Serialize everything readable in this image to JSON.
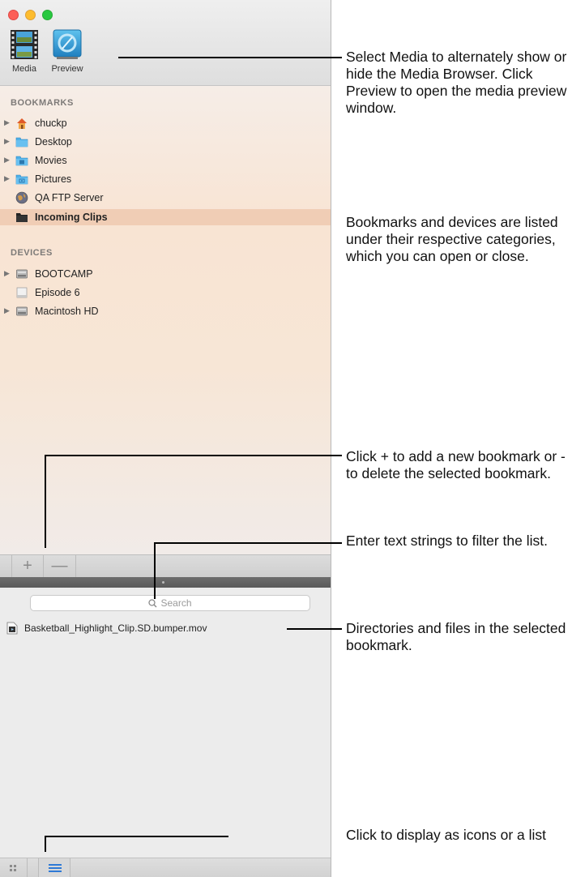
{
  "toolbar": {
    "media_label": "Media",
    "preview_label": "Preview"
  },
  "sidebar": {
    "bookmarks_header": "BOOKMARKS",
    "bookmarks": [
      {
        "label": "chuckp",
        "icon": "home-folder-icon",
        "expandable": true
      },
      {
        "label": "Desktop",
        "icon": "folder-icon",
        "expandable": true
      },
      {
        "label": "Movies",
        "icon": "movies-folder-icon",
        "expandable": true
      },
      {
        "label": "Pictures",
        "icon": "pictures-folder-icon",
        "expandable": true
      },
      {
        "label": "QA FTP Server",
        "icon": "globe-icon",
        "expandable": false
      },
      {
        "label": "Incoming Clips",
        "icon": "black-folder-icon",
        "expandable": false,
        "selected": true
      }
    ],
    "devices_header": "DEVICES",
    "devices": [
      {
        "label": "BOOTCAMP",
        "icon": "drive-icon",
        "expandable": true
      },
      {
        "label": "Episode 6",
        "icon": "disk-image-icon",
        "expandable": false
      },
      {
        "label": "Macintosh HD",
        "icon": "drive-icon",
        "expandable": true
      }
    ]
  },
  "bottom_bar": {
    "add_label": "+",
    "remove_label": "—"
  },
  "browser": {
    "search_placeholder": "Search",
    "files": [
      {
        "name": "Basketball_Highlight_Clip.SD.bumper.mov",
        "icon": "movie-file-icon"
      }
    ]
  },
  "annotations": {
    "toolbar": "Select Media to alternately show or hide the Media Browser. Click Preview to open the media preview window.",
    "bookmarks": "Bookmarks and devices are listed under their respective categories, which you can open or close.",
    "add_remove": "Click + to add a new bookmark or - to delete the selected bookmark.",
    "search": "Enter text strings to filter the list.",
    "files": "Directories and files in the selected bookmark.",
    "view_mode": "Click to display as icons or a list"
  },
  "colors": {
    "selection": "#f0cdb5",
    "close": "#fc5f57",
    "minimize": "#fdbc2e",
    "maximize": "#28c840"
  }
}
